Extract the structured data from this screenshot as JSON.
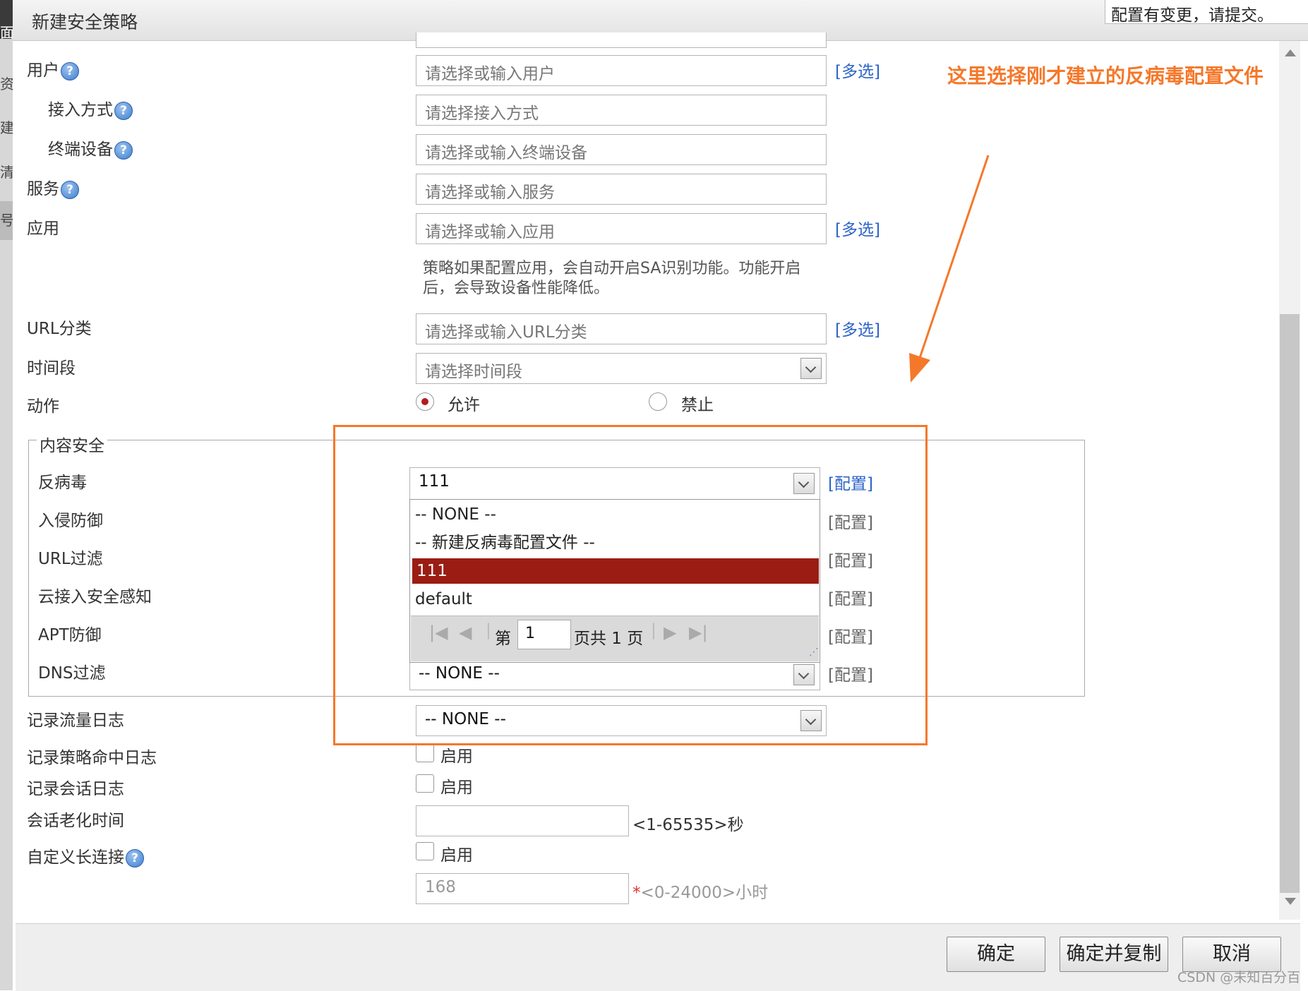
{
  "dialog": {
    "title": "新建安全策略",
    "notice": "配置有变更，请提交。"
  },
  "background_window": {
    "fragments": [
      "面",
      "资面",
      "建",
      "清",
      "号"
    ]
  },
  "form": {
    "user": {
      "label": "用户",
      "placeholder": "请选择或输入用户",
      "multi": "[多选]"
    },
    "access_mode": {
      "label": "接入方式",
      "placeholder": "请选择接入方式"
    },
    "terminal": {
      "label": "终端设备",
      "placeholder": "请选择或输入终端设备"
    },
    "service": {
      "label": "服务",
      "placeholder": "请选择或输入服务"
    },
    "application": {
      "label": "应用",
      "placeholder": "请选择或输入应用",
      "multi": "[多选]",
      "note": "策略如果配置应用，会自动开启SA识别功能。功能开启后，会导致设备性能降低。",
      "note_line1": "策略如果配置应用，会自动开启SA识别功能。功能开启",
      "note_line2": "后，会导致设备性能降低。"
    },
    "url_category": {
      "label": "URL分类",
      "placeholder": "请选择或输入URL分类",
      "multi": "[多选]"
    },
    "time_range": {
      "label": "时间段",
      "placeholder": "请选择时间段"
    },
    "action": {
      "label": "动作",
      "options": [
        "允许",
        "禁止"
      ],
      "selected": "允许"
    },
    "content_security": {
      "legend": "内容安全",
      "antivirus": {
        "label": "反病毒",
        "value": "111",
        "config": "[配置]"
      },
      "intrusion": {
        "label": "入侵防御",
        "config": "[配置]"
      },
      "url_filter": {
        "label": "URL过滤",
        "config": "[配置]"
      },
      "cloud_access": {
        "label": "云接入安全感知",
        "config": "[配置]"
      },
      "apt": {
        "label": "APT防御",
        "config": "[配置]"
      },
      "dns_filter": {
        "label": "DNS过滤",
        "value": "-- NONE --",
        "config": "[配置]"
      }
    },
    "traffic_log": {
      "label": "记录流量日志",
      "value": "-- NONE --"
    },
    "policy_hit_log": {
      "label": "记录策略命中日志",
      "checkbox": "启用"
    },
    "session_log": {
      "label": "记录会话日志",
      "checkbox": "启用"
    },
    "session_aging": {
      "label": "会话老化时间",
      "value": "",
      "hint": "<1-65535>秒"
    },
    "long_connection": {
      "label": "自定义长连接",
      "checkbox": "启用",
      "value": "168",
      "required_mark": "*",
      "hint": "<0-24000>小时"
    }
  },
  "dropdown": {
    "items": [
      "-- NONE --",
      "-- 新建反病毒配置文件 --",
      "111",
      "default"
    ],
    "selected": "111",
    "pager": {
      "prefix": "第",
      "page": "1",
      "suffix": "页共 1 页"
    }
  },
  "buttons": {
    "ok": "确定",
    "ok_copy": "确定并复制",
    "cancel": "取消"
  },
  "annotation": {
    "text": "这里选择刚才建立的反病毒配置文件",
    "color": "#f5782a"
  },
  "watermark": "CSDN @未知百分百",
  "colors": {
    "selected_item": "#9b1c13",
    "link": "#2d64c8",
    "radio_on": "#b01d1d"
  },
  "icons": [
    "help-icon",
    "chevron-down-icon",
    "first-page-icon",
    "prev-page-icon",
    "next-page-icon",
    "last-page-icon",
    "arrow-icon"
  ]
}
